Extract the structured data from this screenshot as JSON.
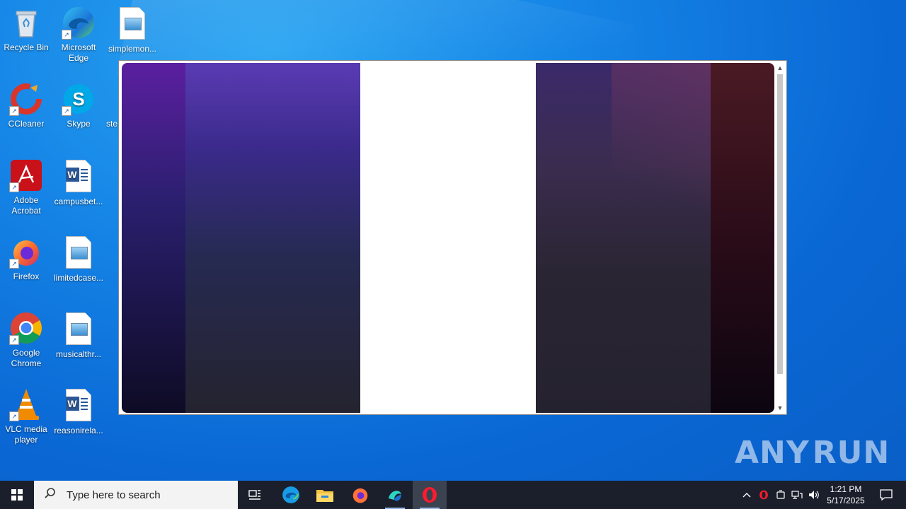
{
  "desktop": {
    "icons": [
      {
        "label": "Recycle Bin",
        "icon": "recycle-bin-icon"
      },
      {
        "label": "Microsoft Edge",
        "icon": "edge-icon"
      },
      {
        "label": "simplemon...",
        "icon": "image-file-icon"
      },
      {
        "label": "CCleaner",
        "icon": "ccleaner-icon"
      },
      {
        "label": "Skype",
        "icon": "skype-icon"
      },
      {
        "label": "ste",
        "icon": "partial-icon"
      },
      {
        "label": "Adobe Acrobat",
        "icon": "acrobat-icon"
      },
      {
        "label": "campusbet...",
        "icon": "word-doc-icon"
      },
      {
        "label": "Firefox",
        "icon": "firefox-icon"
      },
      {
        "label": "limitedcase...",
        "icon": "image-file-icon"
      },
      {
        "label": "Google Chrome",
        "icon": "chrome-icon"
      },
      {
        "label": "musicalthr...",
        "icon": "image-file-icon"
      },
      {
        "label": "VLC media player",
        "icon": "vlc-icon"
      },
      {
        "label": "reasonirela...",
        "icon": "word-doc-icon"
      }
    ]
  },
  "popup": {
    "panel_colors": [
      "#5b1fa0",
      "#3a2a8a",
      "#ffffff",
      "#3a2c4e",
      "#4a1a24"
    ]
  },
  "watermark": {
    "left": "ANY",
    "right": "RUN"
  },
  "taskbar": {
    "search_placeholder": "Type here to search",
    "apps": [
      {
        "name": "task-view",
        "icon": "task-view-icon"
      },
      {
        "name": "edge",
        "icon": "edge-icon"
      },
      {
        "name": "file-explorer",
        "icon": "folder-icon"
      },
      {
        "name": "firefox",
        "icon": "firefox-icon"
      },
      {
        "name": "unknown-app",
        "icon": "app-icon"
      },
      {
        "name": "opera",
        "icon": "opera-icon",
        "active": true
      }
    ],
    "clock": {
      "time": "1:21 PM",
      "date": "5/17/2025"
    },
    "tray_chevron": "^"
  }
}
